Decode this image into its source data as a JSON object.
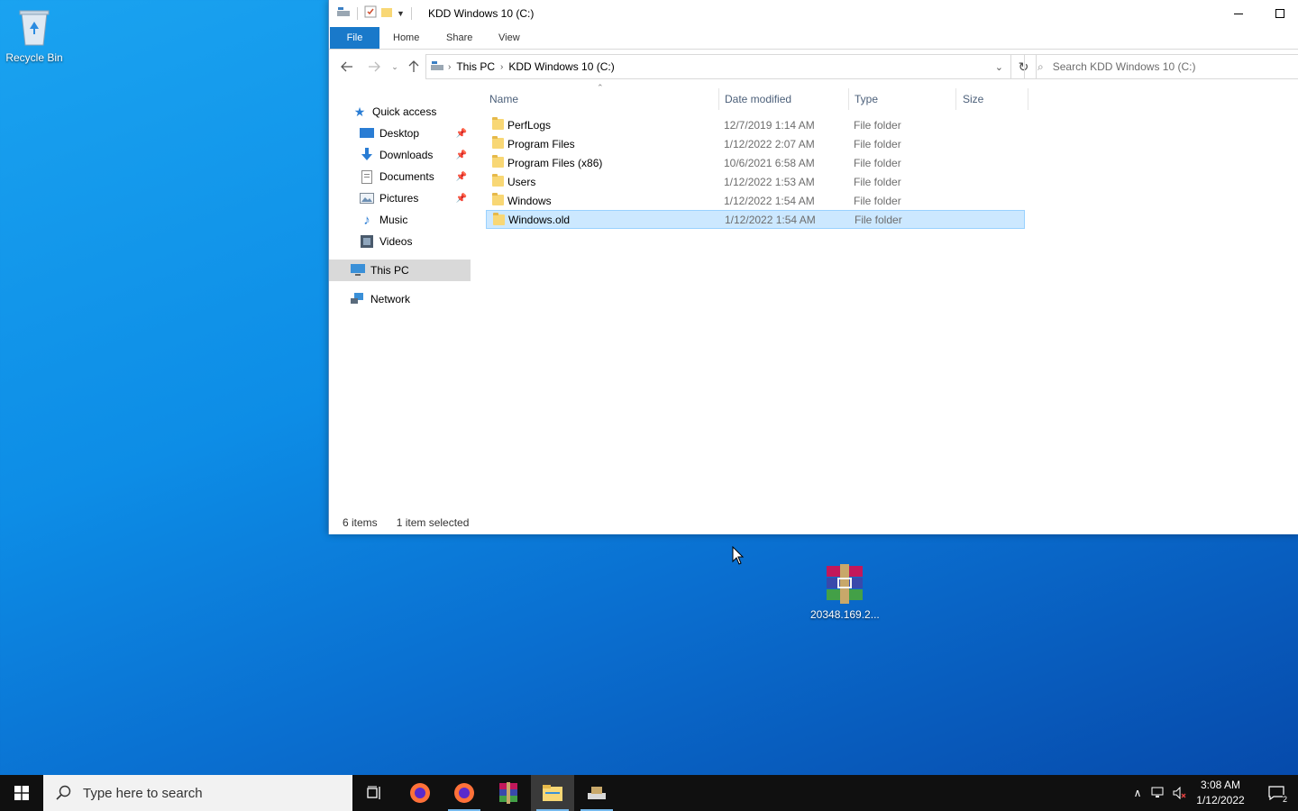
{
  "desktop": {
    "icons": [
      {
        "label": "Recycle Bin",
        "icon": "recycle-bin-icon"
      },
      {
        "label": "20348.169.2...",
        "icon": "winrar-archive-icon"
      }
    ]
  },
  "explorer": {
    "title": "KDD Windows 10 (C:)",
    "ribbon_tabs": [
      "File",
      "Home",
      "Share",
      "View"
    ],
    "address": {
      "crumbs": [
        "This PC",
        "KDD Windows 10 (C:)"
      ]
    },
    "search_placeholder": "Search KDD Windows 10 (C:)",
    "nav": {
      "quick_access": "Quick access",
      "items": [
        {
          "label": "Desktop",
          "icon": "desktop-icon",
          "pinned": true
        },
        {
          "label": "Downloads",
          "icon": "downloads-icon",
          "pinned": true
        },
        {
          "label": "Documents",
          "icon": "documents-icon",
          "pinned": true
        },
        {
          "label": "Pictures",
          "icon": "pictures-icon",
          "pinned": true
        },
        {
          "label": "Music",
          "icon": "music-icon",
          "pinned": false
        },
        {
          "label": "Videos",
          "icon": "videos-icon",
          "pinned": false
        }
      ],
      "this_pc": "This PC",
      "network": "Network"
    },
    "columns": [
      "Name",
      "Date modified",
      "Type",
      "Size"
    ],
    "files": [
      {
        "name": "PerfLogs",
        "date": "12/7/2019 1:14 AM",
        "type": "File folder"
      },
      {
        "name": "Program Files",
        "date": "1/12/2022 2:07 AM",
        "type": "File folder"
      },
      {
        "name": "Program Files (x86)",
        "date": "10/6/2021 6:58 AM",
        "type": "File folder"
      },
      {
        "name": "Users",
        "date": "1/12/2022 1:53 AM",
        "type": "File folder"
      },
      {
        "name": "Windows",
        "date": "1/12/2022 1:54 AM",
        "type": "File folder"
      },
      {
        "name": "Windows.old",
        "date": "1/12/2022 1:54 AM",
        "type": "File folder",
        "selected": true
      }
    ],
    "status": {
      "count": "6 items",
      "selection": "1 item selected"
    }
  },
  "taskbar": {
    "search_placeholder": "Type here to search",
    "apps": [
      "task-view-icon",
      "firefox-icon",
      "firefox-icon",
      "winrar-icon",
      "file-explorer-icon",
      "installer-icon"
    ],
    "time": "3:08 AM",
    "date": "1/12/2022",
    "notification_count": "2"
  },
  "colors": {
    "accent": "#1979ca",
    "selection": "#cce8ff",
    "taskbar": "#101010"
  }
}
